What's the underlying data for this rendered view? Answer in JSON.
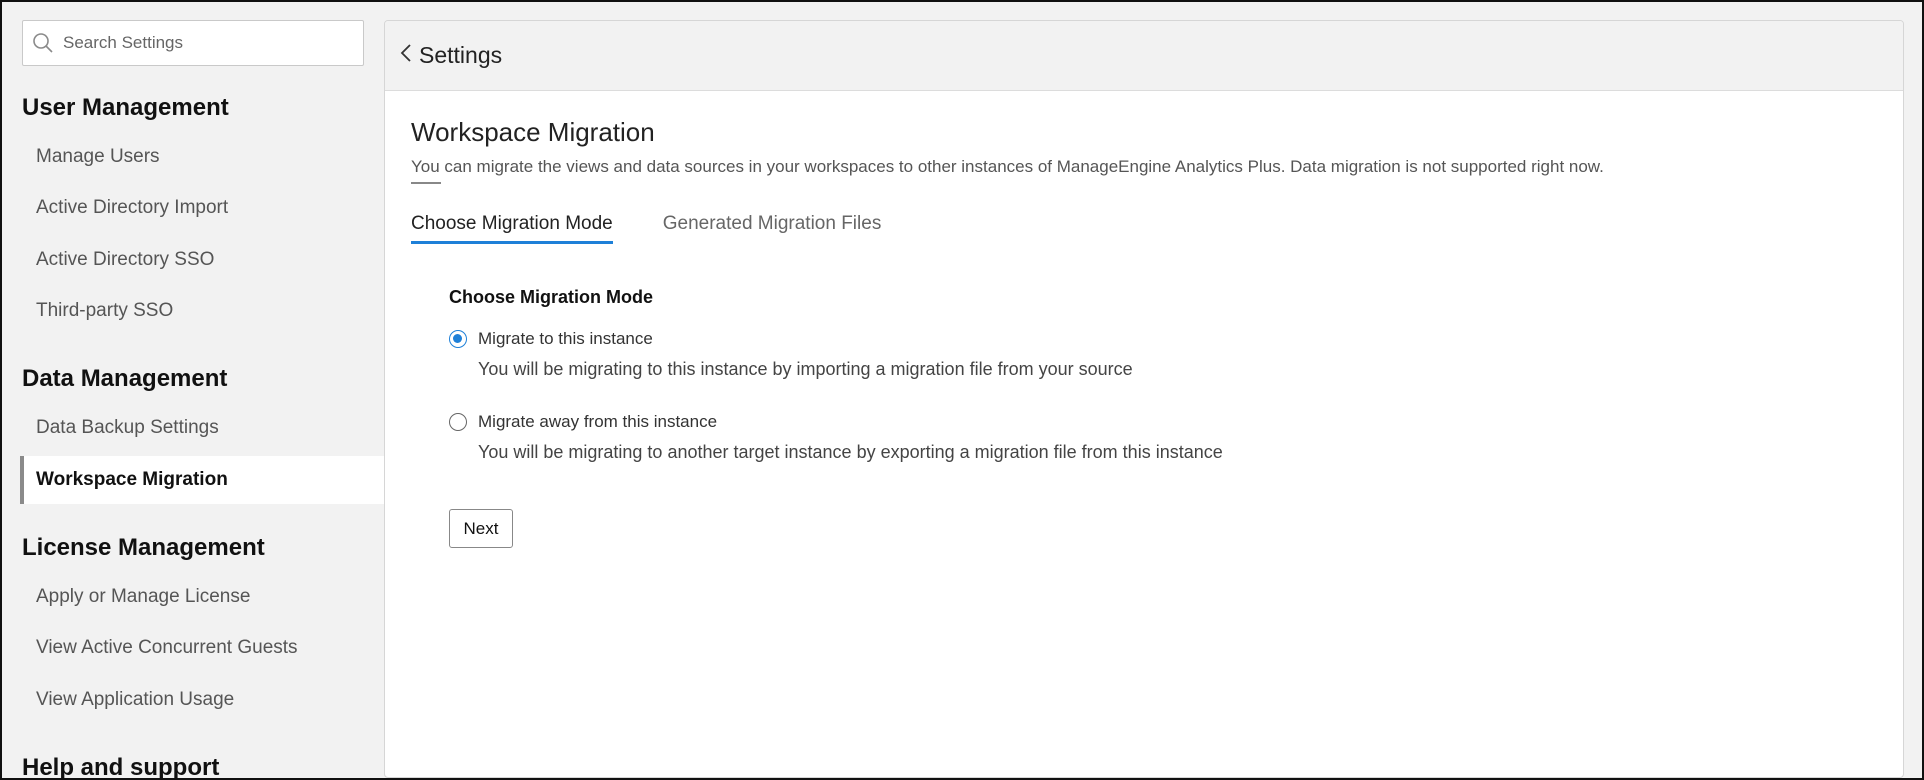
{
  "search": {
    "placeholder": "Search Settings"
  },
  "sidebar": {
    "sections": [
      {
        "title": "User Management"
      },
      {
        "title": "Data Management"
      },
      {
        "title": "License Management"
      },
      {
        "title": "Help and support"
      }
    ],
    "items": [
      {
        "label": "Manage Users"
      },
      {
        "label": "Active Directory Import"
      },
      {
        "label": "Active Directory SSO"
      },
      {
        "label": "Third-party SSO"
      },
      {
        "label": "Data Backup Settings"
      },
      {
        "label": "Workspace Migration"
      },
      {
        "label": "Apply or Manage License"
      },
      {
        "label": "View Active Concurrent Guests"
      },
      {
        "label": "View Application Usage"
      }
    ],
    "active_item": "Workspace Migration"
  },
  "header": {
    "back_label": "Settings"
  },
  "main": {
    "title": "Workspace Migration",
    "description": "You can migrate the views and data sources in your workspaces to other instances of ManageEngine Analytics Plus. Data migration is not supported right now.",
    "tabs": [
      {
        "label": "Choose Migration Mode",
        "active": true
      },
      {
        "label": "Generated Migration Files",
        "active": false
      }
    ],
    "mode_title": "Choose Migration Mode",
    "options": [
      {
        "label": "Migrate to this instance",
        "description": "You will be migrating to this instance by importing a migration file from your source",
        "selected": true
      },
      {
        "label": "Migrate away from this instance",
        "description": "You will be migrating to another target instance by exporting a migration file from this instance",
        "selected": false
      }
    ],
    "next_label": "Next"
  },
  "colors": {
    "accent": "#1e80d8",
    "sidebar_bg": "#f2f2f2"
  }
}
